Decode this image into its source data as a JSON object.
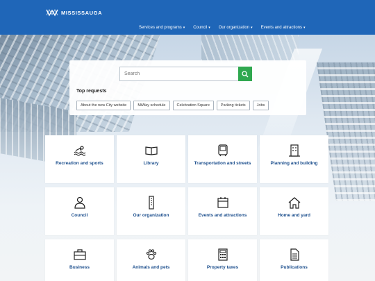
{
  "header": {
    "logo_text": "MISSISSAUGA",
    "nav": [
      {
        "label": "Services and programs"
      },
      {
        "label": "Council"
      },
      {
        "label": "Our organization"
      },
      {
        "label": "Events and attractions"
      }
    ]
  },
  "search": {
    "placeholder": "Search",
    "button_icon": "search-icon"
  },
  "top_requests": {
    "title": "Top requests",
    "chips": [
      {
        "label": "About the new City website"
      },
      {
        "label": "MiWay schedule"
      },
      {
        "label": "Celebration Square"
      },
      {
        "label": "Parking tickets"
      },
      {
        "label": "Jobs"
      }
    ]
  },
  "tiles": [
    {
      "label": "Recreation and sports",
      "icon": "swimmer-icon"
    },
    {
      "label": "Library",
      "icon": "book-icon"
    },
    {
      "label": "Transportation and streets",
      "icon": "bus-icon"
    },
    {
      "label": "Planning and building",
      "icon": "building-icon"
    },
    {
      "label": "Council",
      "icon": "person-icon"
    },
    {
      "label": "Our organization",
      "icon": "org-icon"
    },
    {
      "label": "Events and attractions",
      "icon": "calendar-icon"
    },
    {
      "label": "Home and yard",
      "icon": "home-icon"
    },
    {
      "label": "Business",
      "icon": "briefcase-icon"
    },
    {
      "label": "Animals and pets",
      "icon": "paw-icon"
    },
    {
      "label": "Property taxes",
      "icon": "calculator-icon"
    },
    {
      "label": "Publications",
      "icon": "document-icon"
    }
  ],
  "colors": {
    "header_bg": "#1f66b8",
    "search_button": "#2fa84f",
    "tile_label": "#1a4d8c"
  }
}
